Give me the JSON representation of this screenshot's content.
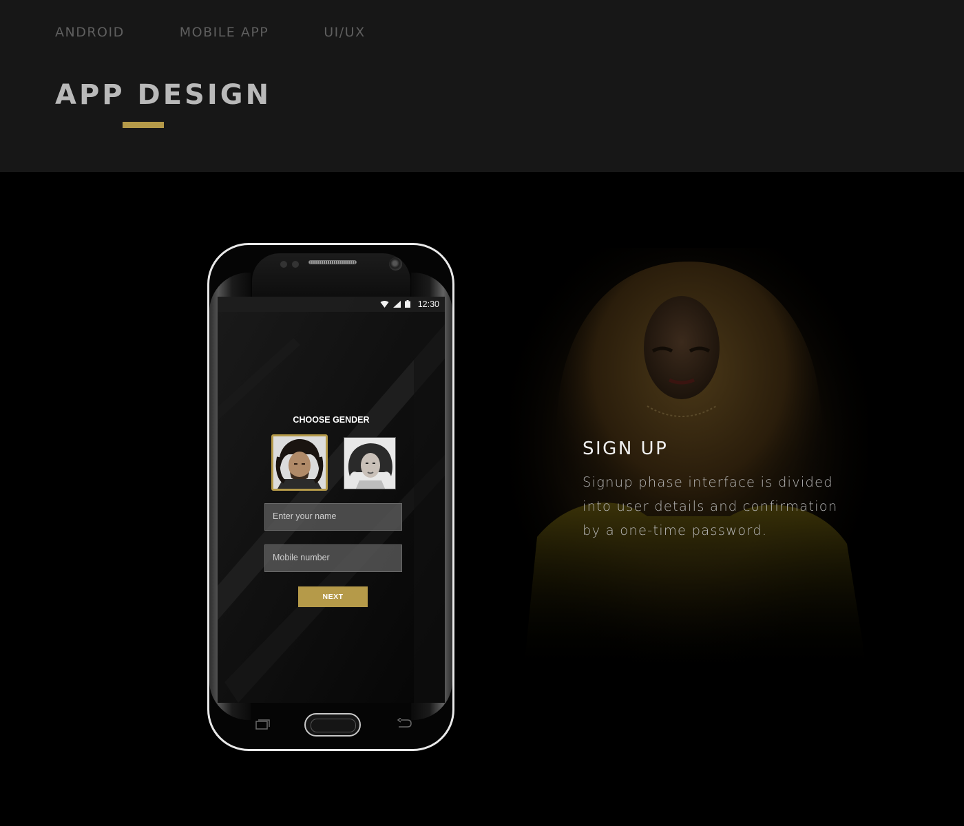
{
  "header": {
    "tags": [
      "ANDROID",
      "MOBILE APP",
      "UI/UX"
    ],
    "title": "APP DESIGN"
  },
  "colors": {
    "accent": "#b59a49",
    "header_bg": "#171717",
    "main_bg": "#000000"
  },
  "phone": {
    "status_time": "12:30",
    "status_icons": [
      "wifi-icon",
      "signal-icon",
      "battery-icon"
    ],
    "choose_label": "CHOOSE GENDER",
    "gender_options": [
      "male",
      "female"
    ],
    "selected_gender": "male",
    "name_placeholder": "Enter your name",
    "mobile_placeholder": "Mobile number",
    "next_label": "NEXT",
    "nav_icons": [
      "recent-apps-icon",
      "home-button",
      "back-icon"
    ]
  },
  "section": {
    "title": "SIGN UP",
    "description": "Signup phase interface is divided into user details and confirmation by a one-time password."
  }
}
